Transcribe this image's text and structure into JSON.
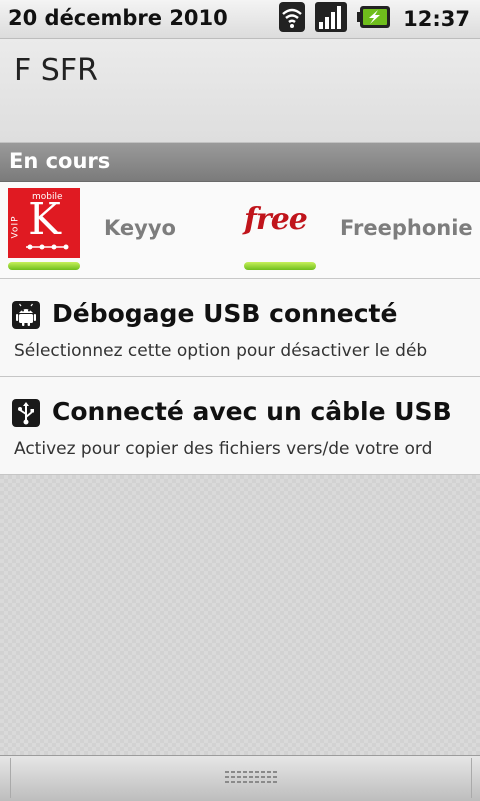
{
  "status_bar": {
    "date": "20 décembre 2010",
    "time": "12:37",
    "icons": [
      "wifi-icon",
      "signal-bars-icon",
      "battery-charging-icon"
    ]
  },
  "carrier": {
    "name": "F SFR"
  },
  "ongoing": {
    "header": "En cours",
    "apps": [
      {
        "label": "Keyyo",
        "icon": "keyyo-logo-icon",
        "logo_texts": [
          "VoIP",
          "mobile",
          "K"
        ]
      },
      {
        "label": "Freephonie",
        "icon": "free-logo-icon",
        "logo_text": "free"
      }
    ],
    "indicator_color": "#7cc424"
  },
  "notifications": [
    {
      "icon": "android-debug-icon",
      "title": "Débogage USB connecté",
      "text": "Sélectionnez cette option pour désactiver le déb"
    },
    {
      "icon": "usb-icon",
      "title": "Connecté avec un câble USB",
      "text": "Activez pour copier des fichiers vers/de votre ord"
    }
  ],
  "colors": {
    "section_header": "#8a8a8a",
    "keyyo_red": "#e01a22",
    "free_red": "#c0141b"
  }
}
